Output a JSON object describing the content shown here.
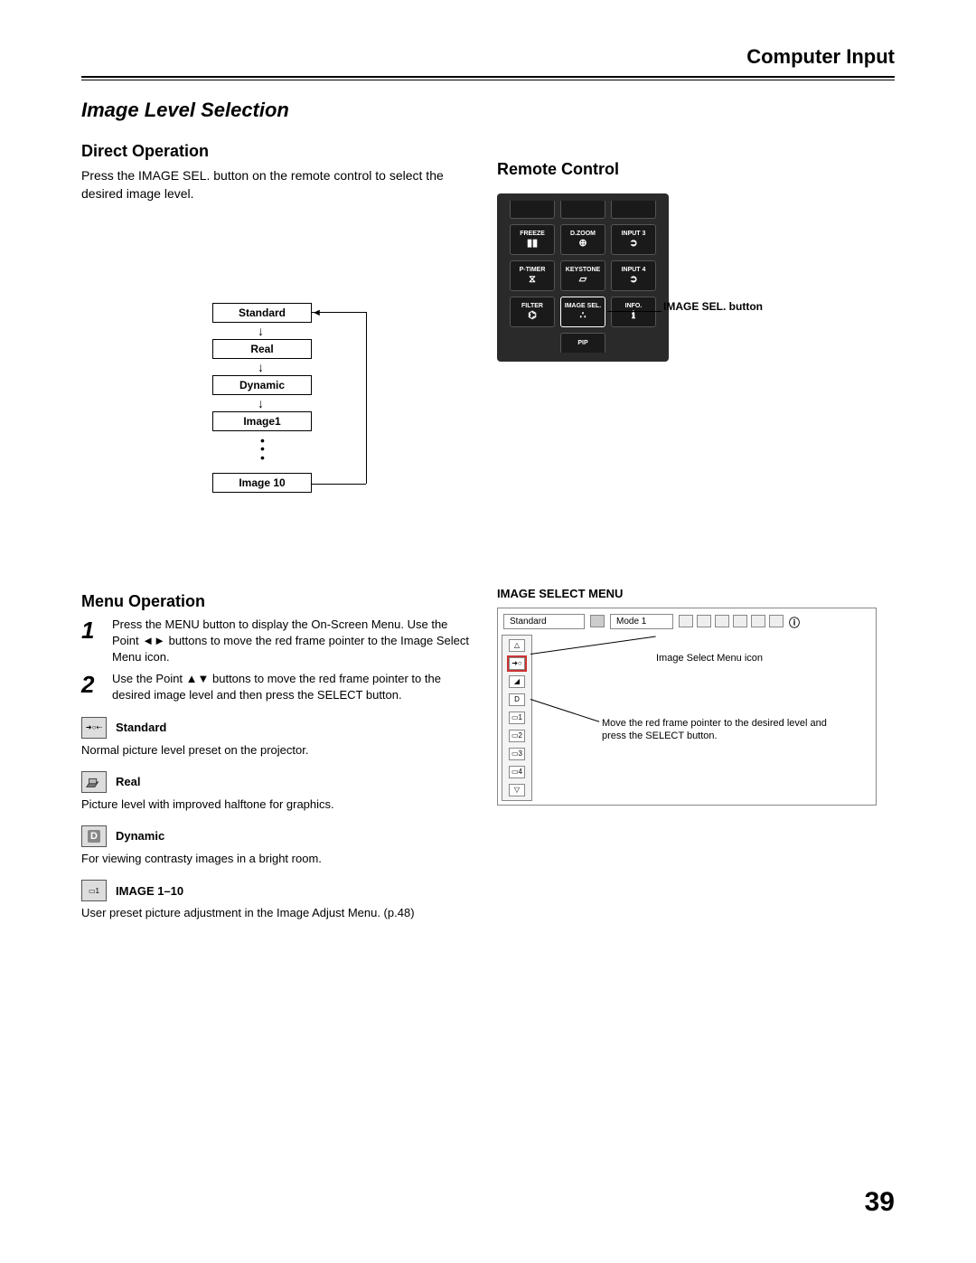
{
  "header": {
    "chapter": "Computer Input"
  },
  "section_title": "Image Level Selection",
  "direct_op": {
    "heading": "Direct Operation",
    "text": "Press the IMAGE SEL. button on the remote control to select the desired image level."
  },
  "cycle": {
    "items": [
      "Standard",
      "Real",
      "Dynamic",
      "Image1",
      "Image 10"
    ]
  },
  "remote": {
    "heading": "Remote Control",
    "buttons": {
      "r1": [
        "FREEZE",
        "D.ZOOM",
        "INPUT 3"
      ],
      "r2": [
        "P-TIMER",
        "KEYSTONE",
        "INPUT 4"
      ],
      "r3": [
        "FILTER",
        "IMAGE SEL.",
        "INFO."
      ],
      "pip": "PIP"
    },
    "callout": "IMAGE SEL. button"
  },
  "menu_op": {
    "heading": "Menu Operation",
    "step1": "Press the MENU button to display the On-Screen Menu. Use the Point ◄► buttons to move the red frame pointer to the Image Select Menu icon.",
    "step2": "Use the Point ▲▼ buttons to move the red frame pointer to the desired image level and then press the SELECT button.",
    "modes": {
      "standard": {
        "label": "Standard",
        "desc": "Normal picture level preset on the projector."
      },
      "real": {
        "label": "Real",
        "desc": "Picture level with improved halftone for graphics."
      },
      "dynamic": {
        "label": "Dynamic",
        "desc": "For viewing contrasty images in a bright room."
      },
      "image110": {
        "label": "IMAGE 1–10",
        "desc": "User preset picture adjustment in the Image Adjust Menu. (p.48)"
      }
    }
  },
  "ism": {
    "heading": "IMAGE SELECT MENU",
    "top_label": "Standard",
    "mode_label": "Mode 1",
    "callout1": "Image Select Menu icon",
    "callout2": "Move the red frame pointer to the desired level and press the SELECT button."
  },
  "page_number": "39"
}
